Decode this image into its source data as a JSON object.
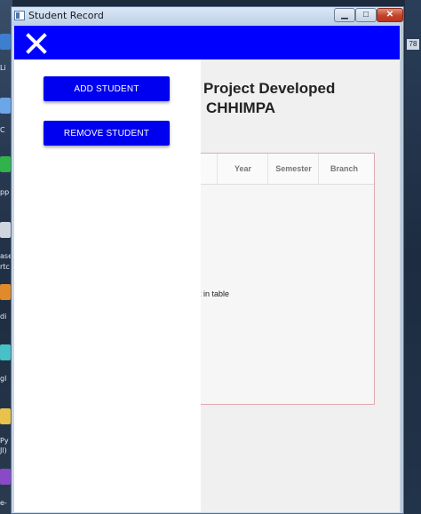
{
  "window": {
    "title": "Student Record",
    "controls": {
      "minimize": "▁",
      "maximize": "□",
      "close": "✕"
    }
  },
  "app_bar": {
    "color": "#0000ff",
    "close_icon": "close-icon"
  },
  "headline": {
    "line1": "Project Developed",
    "line2": "CHHIMPA"
  },
  "table": {
    "columns": [
      "Year",
      "Semester",
      "Branch"
    ],
    "empty_message": "nt in table"
  },
  "drawer": {
    "buttons": [
      {
        "label": "ADD STUDENT"
      },
      {
        "label": "REMOVE STUDENT"
      }
    ],
    "button_color": "#0000f0"
  },
  "desktop": {
    "badge": "78",
    "left_labels": [
      "T",
      "ro",
      "Li",
      "C",
      "pp",
      "ase",
      "rtc",
      "di",
      "gl",
      "Py",
      "Jl)",
      "e-"
    ]
  }
}
